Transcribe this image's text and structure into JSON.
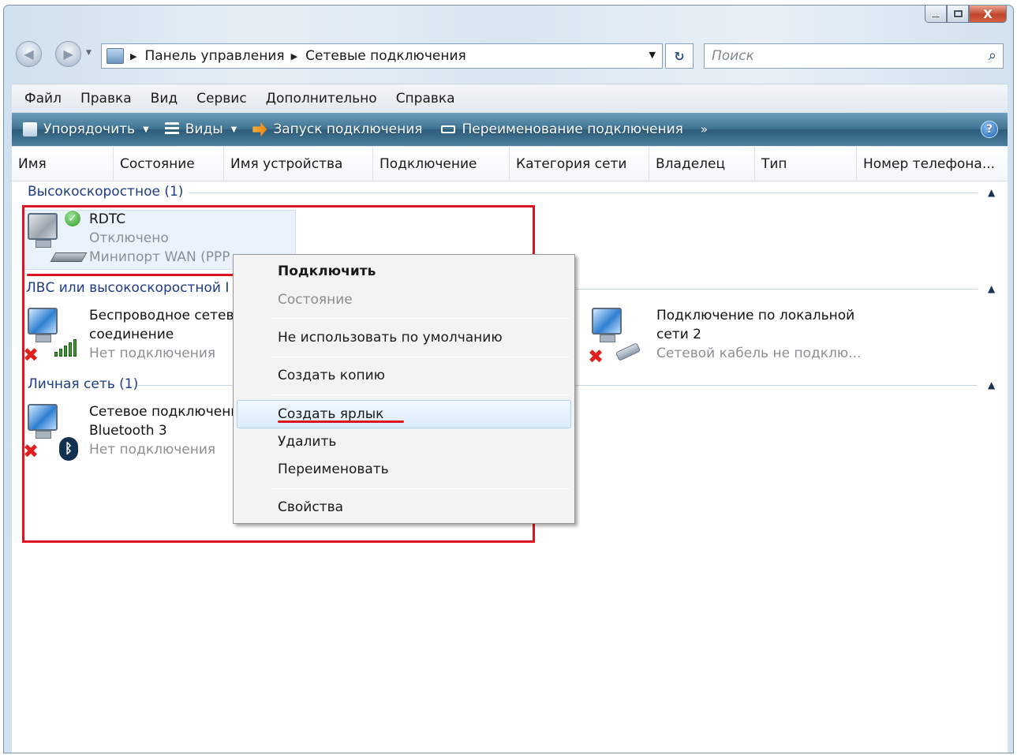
{
  "window": {
    "close_glyph": "X"
  },
  "address_bar": {
    "crumbs": [
      "Панель управления",
      "Сетевые подключения"
    ],
    "search_placeholder": "Поиск"
  },
  "menu": [
    "Файл",
    "Правка",
    "Вид",
    "Сервис",
    "Дополнительно",
    "Справка"
  ],
  "toolbar": {
    "organize": "Упорядочить",
    "views": "Виды",
    "start_connection": "Запуск подключения",
    "rename_connection": "Переименование подключения",
    "more": "»",
    "help": "?"
  },
  "columns": [
    "Имя",
    "Состояние",
    "Имя устройства",
    "Подключение",
    "Категория сети",
    "Владелец",
    "Тип",
    "Номер телефона..."
  ],
  "groups": {
    "highspeed": {
      "title": "Высокоскоростное (1)",
      "items": [
        {
          "name": "RDTC",
          "status": "Отключено",
          "device": "Минипорт WAN (PPP"
        }
      ]
    },
    "lan": {
      "title": "ЛВС или высокоскоростной I",
      "items": [
        {
          "name_line1": "Беспроводное сетев",
          "name_line2": "соединение",
          "status": "Нет подключения"
        },
        {
          "name_line1": "Подключение по локальной",
          "name_line2": "сети 2",
          "status": "Сетевой кабель не подклю..."
        }
      ]
    },
    "pan": {
      "title": "Личная сеть (1)",
      "items": [
        {
          "name_line1": "Сетевое подключени",
          "name_line2": "Bluetooth 3",
          "status": "Нет подключения"
        }
      ]
    }
  },
  "context_menu": {
    "items": [
      "Подключить",
      "Состояние",
      "Не использовать по умолчанию",
      "Создать копию",
      "Создать ярлык",
      "Удалить",
      "Переименовать",
      "Свойства"
    ],
    "highlighted": "Создать ярлык"
  }
}
